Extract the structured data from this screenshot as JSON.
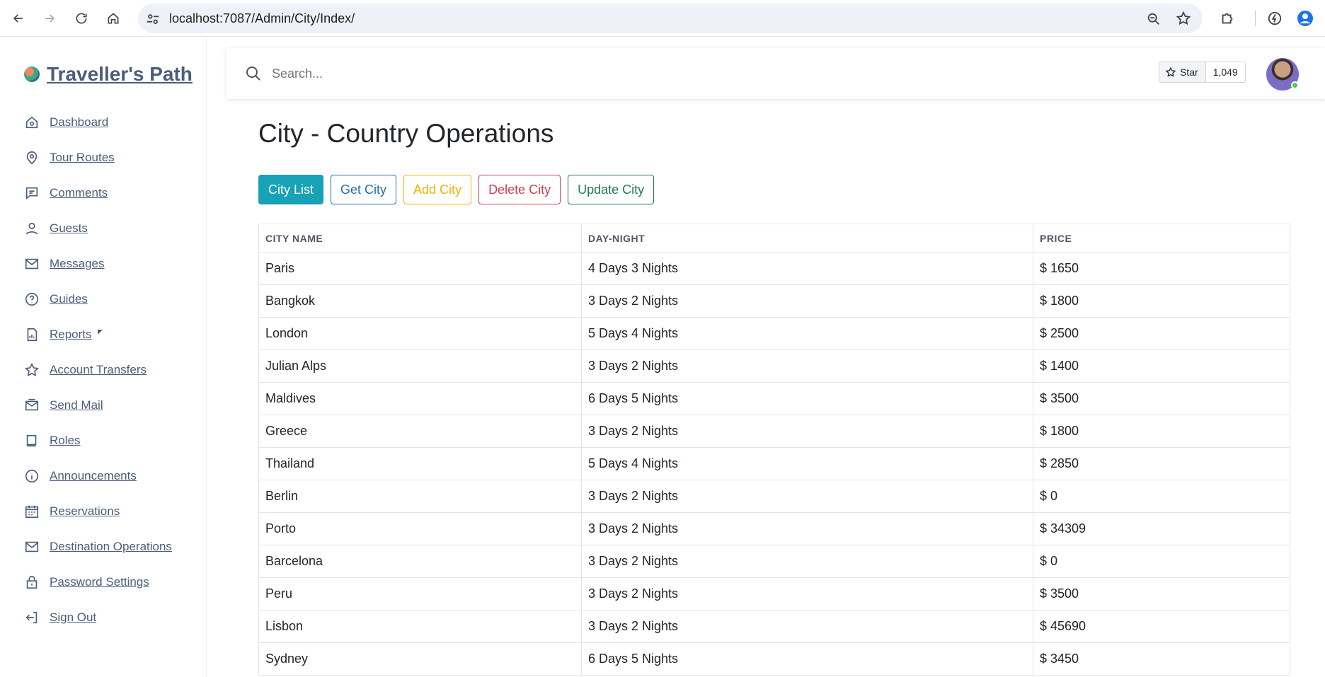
{
  "browser": {
    "url": "localhost:7087/Admin/City/Index/"
  },
  "brand": {
    "name": "Traveller's Path"
  },
  "sidebar": {
    "items": [
      {
        "label": "Dashboard",
        "icon": "home-icon"
      },
      {
        "label": "Tour Routes",
        "icon": "map-pin-icon"
      },
      {
        "label": "Comments",
        "icon": "comment-icon"
      },
      {
        "label": "Guests",
        "icon": "user-icon"
      },
      {
        "label": "Messages",
        "icon": "mail-icon"
      },
      {
        "label": "Guides",
        "icon": "help-icon"
      },
      {
        "label": "Reports",
        "icon": "report-icon"
      },
      {
        "label": "Account Transfers",
        "icon": "star-icon"
      },
      {
        "label": "Send Mail",
        "icon": "send-mail-icon"
      },
      {
        "label": "Roles",
        "icon": "book-icon"
      },
      {
        "label": "Announcements",
        "icon": "info-icon"
      },
      {
        "label": "Reservations",
        "icon": "calendar-icon"
      },
      {
        "label": "Destination Operations",
        "icon": "mail-icon"
      },
      {
        "label": "Password Settings",
        "icon": "lock-icon"
      },
      {
        "label": "Sign Out",
        "icon": "sign-out-icon"
      }
    ]
  },
  "topbar": {
    "search_placeholder": "Search...",
    "star_label": "Star",
    "star_count": "1,049"
  },
  "main": {
    "title": "City - Country Operations",
    "buttons": {
      "city_list": "City List",
      "get_city": "Get City",
      "add_city": "Add City",
      "delete_city": "Delete City",
      "update_city": "Update City"
    },
    "table": {
      "headers": [
        "CITY NAME",
        "DAY-NIGHT",
        "PRICE"
      ],
      "rows": [
        [
          "Paris",
          "4 Days 3 Nights",
          "$ 1650"
        ],
        [
          "Bangkok",
          "3 Days 2 Nights",
          "$ 1800"
        ],
        [
          "London",
          "5 Days 4 Nights",
          "$ 2500"
        ],
        [
          "Julian Alps",
          "3 Days 2 Nights",
          "$ 1400"
        ],
        [
          "Maldives",
          "6 Days 5 Nights",
          "$ 3500"
        ],
        [
          "Greece",
          "3 Days 2 Nights",
          "$ 1800"
        ],
        [
          "Thailand",
          "5 Days 4 Nights",
          "$ 2850"
        ],
        [
          "Berlin",
          "3 Days 2 Nights",
          "$ 0"
        ],
        [
          "Porto",
          "3 Days 2 Nights",
          "$ 34309"
        ],
        [
          "Barcelona",
          "3 Days 2 Nights",
          "$ 0"
        ],
        [
          "Peru",
          "3 Days 2 Nights",
          "$ 3500"
        ],
        [
          "Lisbon",
          "3 Days 2 Nights",
          "$ 45690"
        ],
        [
          "Sydney",
          "6 Days 5 Nights",
          "$ 3450"
        ]
      ]
    }
  }
}
